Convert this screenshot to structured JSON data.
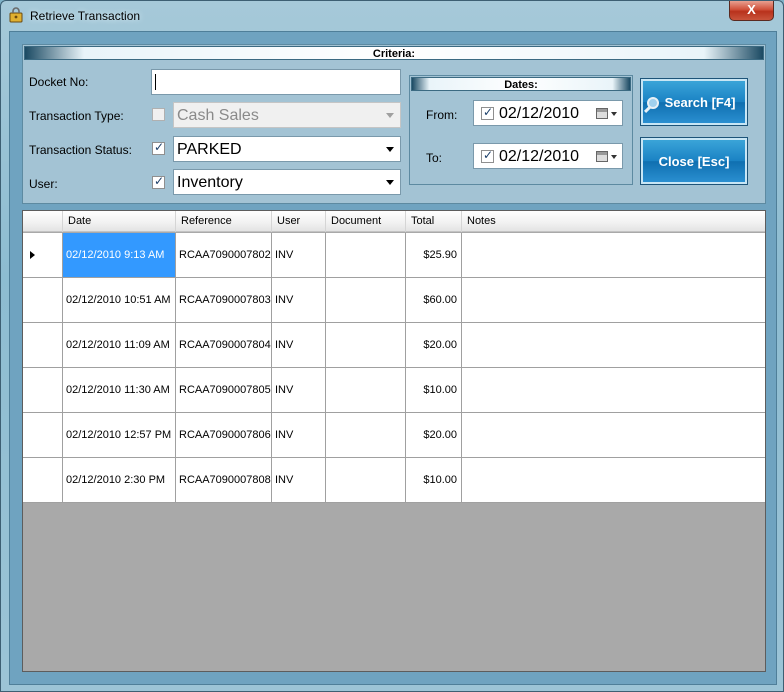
{
  "window": {
    "title": "Retrieve Transaction",
    "close_label": "X"
  },
  "criteria": {
    "title": "Criteria:",
    "docket_label": "Docket No:",
    "docket_value": "",
    "type_label": "Transaction Type:",
    "type_checked": false,
    "type_value": "Cash Sales",
    "status_label": "Transaction Status:",
    "status_checked": true,
    "status_value": "PARKED",
    "user_label": "User:",
    "user_checked": true,
    "user_value": "Inventory"
  },
  "dates": {
    "title": "Dates:",
    "from_label": "From:",
    "from_value": "02/12/2010",
    "to_label": "To:",
    "to_value": "02/12/2010"
  },
  "buttons": {
    "search_label": "Search [F4]",
    "close_label": "Close [Esc]"
  },
  "grid": {
    "columns": [
      "Date",
      "Reference",
      "User",
      "Document",
      "Total",
      "Notes"
    ],
    "rows": [
      {
        "date": "02/12/2010 9:13 AM",
        "reference": "RCAA7090007802",
        "user": "INV",
        "document": "",
        "total": "$25.90",
        "notes": ""
      },
      {
        "date": "02/12/2010 10:51 AM",
        "reference": "RCAA7090007803",
        "user": "INV",
        "document": "",
        "total": "$60.00",
        "notes": ""
      },
      {
        "date": "02/12/2010 11:09 AM",
        "reference": "RCAA7090007804",
        "user": "INV",
        "document": "",
        "total": "$20.00",
        "notes": ""
      },
      {
        "date": "02/12/2010 11:30 AM",
        "reference": "RCAA7090007805",
        "user": "INV",
        "document": "",
        "total": "$10.00",
        "notes": ""
      },
      {
        "date": "02/12/2010 12:57 PM",
        "reference": "RCAA7090007806",
        "user": "INV",
        "document": "",
        "total": "$20.00",
        "notes": ""
      },
      {
        "date": "02/12/2010 2:30 PM",
        "reference": "RCAA7090007808",
        "user": "INV",
        "document": "",
        "total": "$10.00",
        "notes": ""
      }
    ]
  }
}
